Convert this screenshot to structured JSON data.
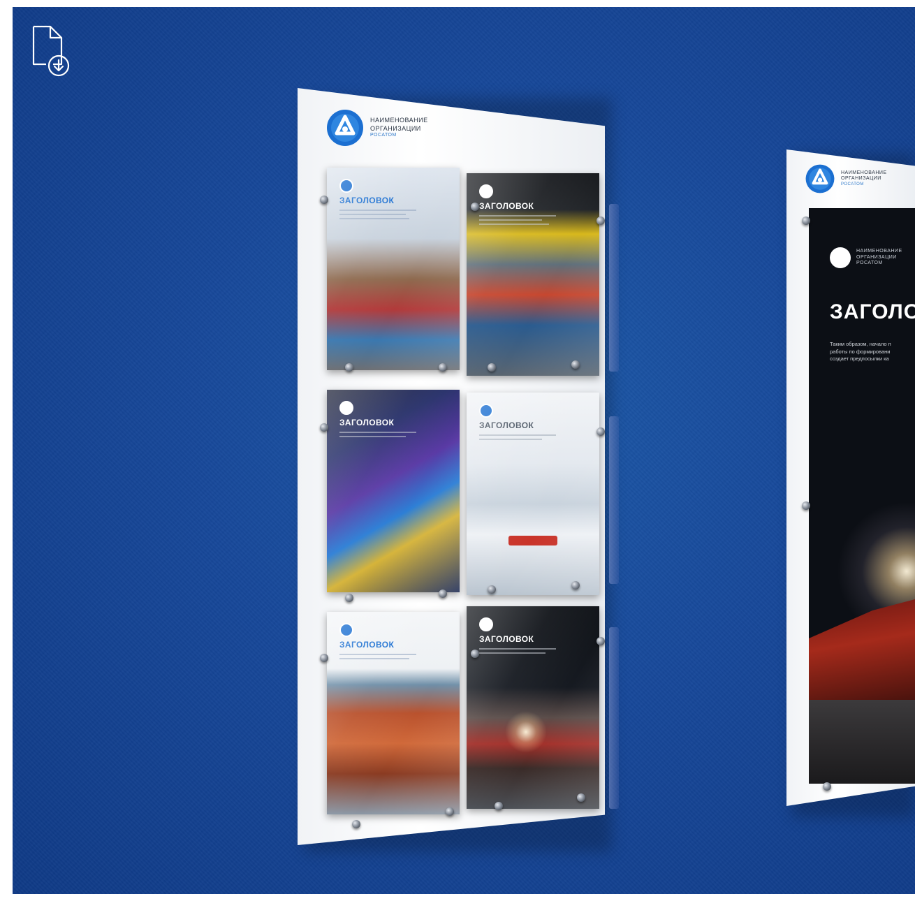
{
  "toolbar": {
    "download_icon": "file-download-icon"
  },
  "left_stand": {
    "logo": {
      "line1": "НАИМЕНОВАНИЕ",
      "line2": "ОРГАНИЗАЦИИ",
      "brand": "РОСАТОМ"
    },
    "pockets": [
      {
        "title": "ЗАГОЛОВОК",
        "theme": "light"
      },
      {
        "title": "ЗАГОЛОВОК",
        "theme": "dark"
      },
      {
        "title": "ЗАГОЛОВОК",
        "theme": "dark"
      },
      {
        "title": "ЗАГОЛОВОК",
        "theme": "light"
      },
      {
        "title": "ЗАГОЛОВОК",
        "theme": "light"
      },
      {
        "title": "ЗАГОЛОВОК",
        "theme": "dark"
      }
    ]
  },
  "right_stand": {
    "logo": {
      "line1": "НАИМЕНОВАНИЕ",
      "line2": "ОРГАНИЗАЦИИ",
      "brand": "РОСАТОМ"
    },
    "poster": {
      "title": "ЗАГОЛО",
      "body_line1": "Таким образом, начало п",
      "body_line2": "работы по формировани",
      "body_line3": "создает предпосылки ка"
    }
  },
  "colors": {
    "wall": "#17489a",
    "stand": "#ffffff",
    "accent": "#1b6fd1"
  }
}
